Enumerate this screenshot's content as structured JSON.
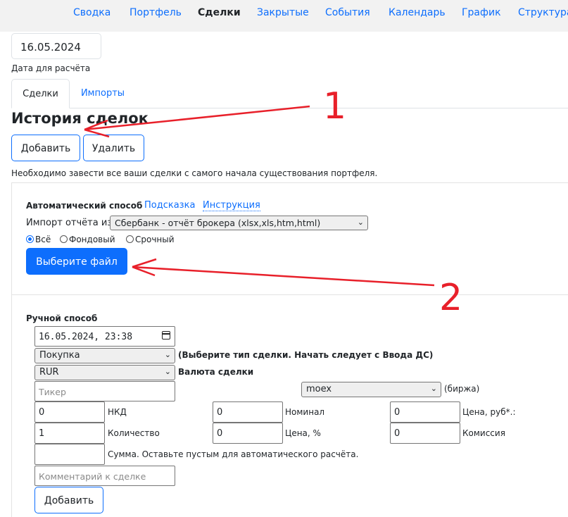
{
  "nav": {
    "items": [
      {
        "label": "Сводка",
        "active": false
      },
      {
        "label": "Портфель",
        "active": false
      },
      {
        "label": "Сделки",
        "active": true
      },
      {
        "label": "Закрытые",
        "active": false
      },
      {
        "label": "События",
        "active": false
      },
      {
        "label": "Календарь",
        "active": false
      },
      {
        "label": "График",
        "active": false
      },
      {
        "label": "Структура",
        "active": false
      }
    ]
  },
  "calc_date": {
    "value": "16.05.2024",
    "caption": "Дата для расчёта"
  },
  "tabs": [
    {
      "label": "Сделки",
      "active": true
    },
    {
      "label": "Импорты",
      "active": false
    }
  ],
  "history": {
    "title": "История сделок",
    "add_label": "Добавить",
    "delete_label": "Удалить",
    "note": "Необходимо завести все ваши сделки с самого начала существования портфеля."
  },
  "auto": {
    "heading": "Автоматический способ",
    "hint_link": "Подсказка",
    "instruction_link": "Инструкция",
    "import_label": "Импорт отчёта из",
    "import_selected": "Сбербанк - отчёт брокера (xlsx,xls,htm,html)",
    "radios": [
      {
        "label": "Всё",
        "checked": true
      },
      {
        "label": "Фондовый",
        "checked": false
      },
      {
        "label": "Срочный",
        "checked": false
      }
    ],
    "file_button": "Выберите файл"
  },
  "manual": {
    "heading": "Ручной способ",
    "datetime": "16.05.2024, 23:38",
    "deal_type": "Покупка",
    "deal_type_note": "(Выберите тип сделки. Начать следует с Ввода ДС)",
    "currency": "RUR",
    "currency_note": "Валюта сделки",
    "ticker_placeholder": "Тикер",
    "exchange": "moex",
    "exchange_note": "(биржа)",
    "nkd_value": "0",
    "nkd_label": "НКД",
    "nominal_value": "0",
    "nominal_label": "Номинал",
    "price_rub_value": "0",
    "price_rub_label": "Цена, руб*.:",
    "qty_value": "1",
    "qty_label": "Количество",
    "price_pct_value": "0",
    "price_pct_label": "Цена, %",
    "commission_value": "0",
    "commission_label": "Комиссия",
    "sum_value": "",
    "sum_label": "Сумма. Оставьте пустым для автоматического расчёта.",
    "comment_placeholder": "Комментарий к сделке",
    "add_label": "Добавить"
  },
  "annotations": {
    "one": "1",
    "two": "2",
    "color": "#e8202a"
  },
  "colors": {
    "accent": "#0d6efd",
    "nav_bg": "#f2f2f2"
  },
  "icons": {
    "calendar": "calendar-icon",
    "chevron": "chevron-down-icon"
  }
}
